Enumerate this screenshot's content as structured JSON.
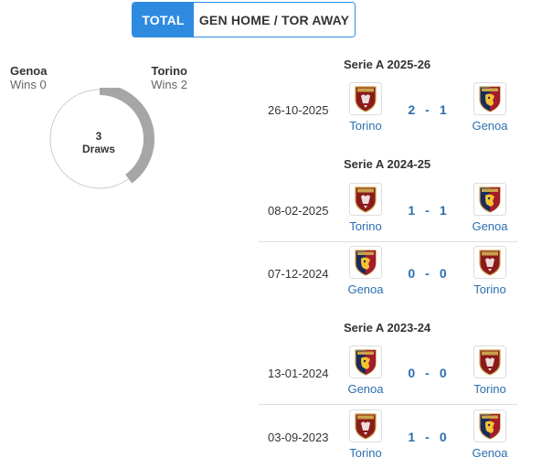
{
  "tabs": {
    "total": "TOTAL",
    "split": "GEN HOME / TOR AWAY"
  },
  "summary": {
    "left": {
      "name": "Genoa",
      "wins": "Wins 0"
    },
    "right": {
      "name": "Torino",
      "wins": "Wins 2"
    },
    "draws_count": "3",
    "draws_label": "Draws",
    "torino_share": 0.4,
    "colors": {
      "torino_arc": "#a6a6a6",
      "ring": "#cccccc"
    }
  },
  "seasons": [
    {
      "title": "Serie A 2025-26"
    },
    {
      "title": "Serie A 2024-25"
    },
    {
      "title": "Serie A 2023-24"
    }
  ],
  "matches": [
    {
      "date": "26-10-2025",
      "home": "Torino",
      "home_icon": "torino-crest-icon",
      "home_score": "2",
      "away_score": "1",
      "away": "Genoa",
      "away_icon": "genoa-crest-icon"
    },
    {
      "date": "08-02-2025",
      "home": "Torino",
      "home_icon": "torino-crest-icon",
      "home_score": "1",
      "away_score": "1",
      "away": "Genoa",
      "away_icon": "genoa-crest-icon"
    },
    {
      "date": "07-12-2024",
      "home": "Genoa",
      "home_icon": "genoa-crest-icon",
      "home_score": "0",
      "away_score": "0",
      "away": "Torino",
      "away_icon": "torino-crest-icon"
    },
    {
      "date": "13-01-2024",
      "home": "Genoa",
      "home_icon": "genoa-crest-icon",
      "home_score": "0",
      "away_score": "0",
      "away": "Torino",
      "away_icon": "torino-crest-icon"
    },
    {
      "date": "03-09-2023",
      "home": "Torino",
      "home_icon": "torino-crest-icon",
      "home_score": "1",
      "away_score": "0",
      "away": "Genoa",
      "away_icon": "genoa-crest-icon"
    }
  ],
  "score_separator": "-"
}
